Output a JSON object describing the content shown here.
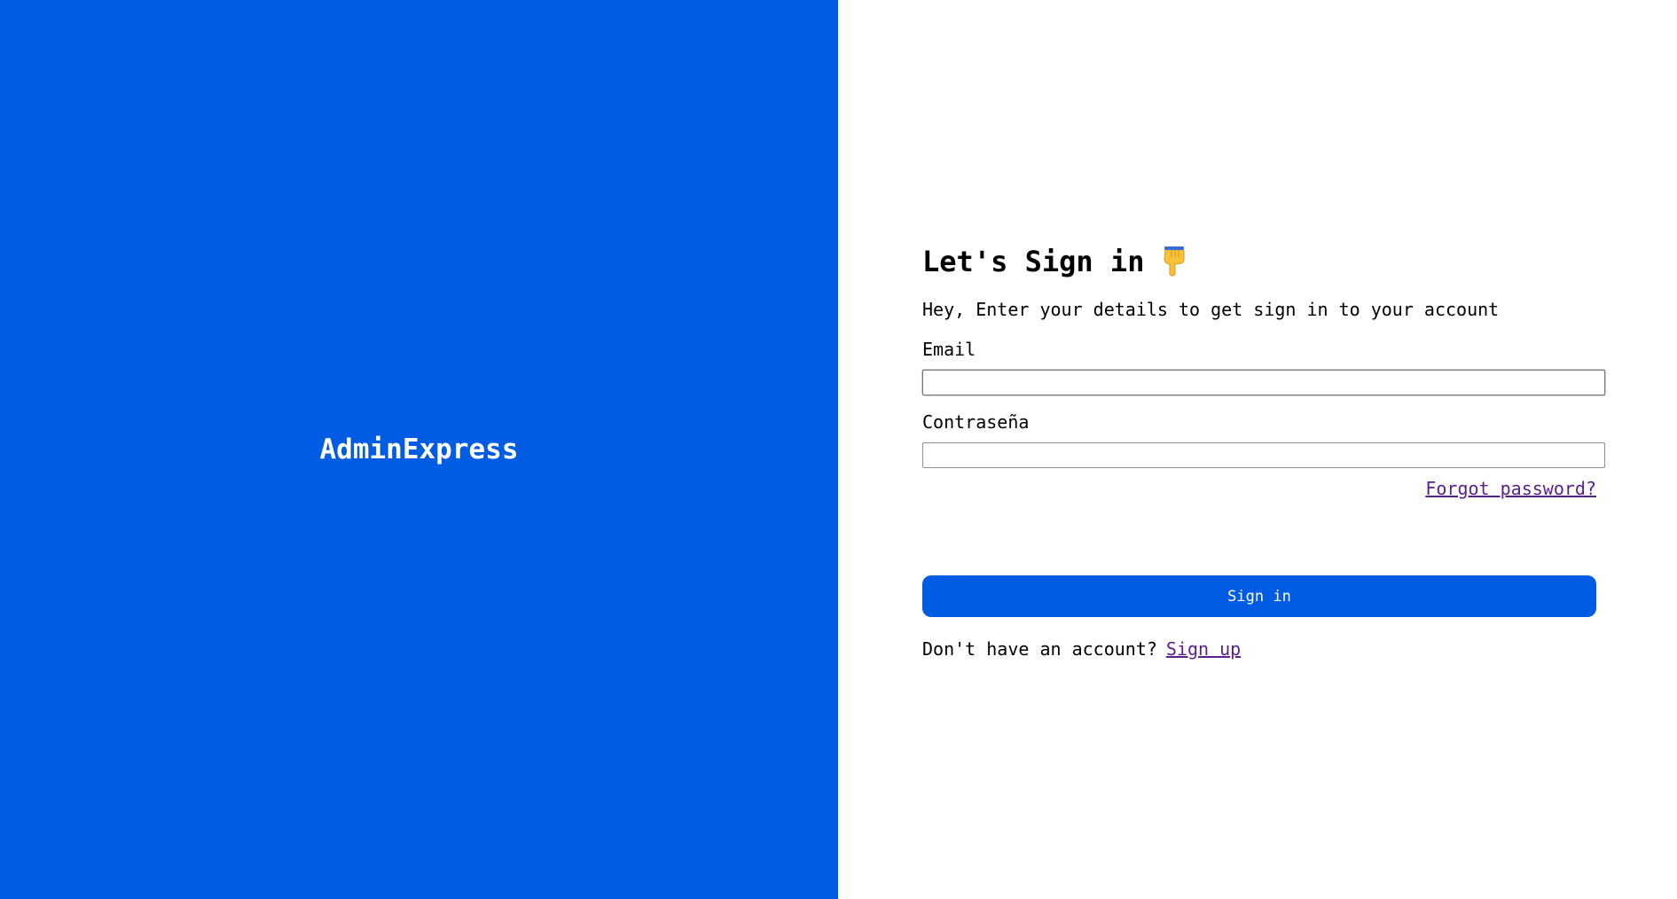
{
  "brand": {
    "name": "AdminExpress",
    "panel_color": "#005ce3"
  },
  "signin": {
    "title": "Let's Sign in",
    "title_icon": "backhand-index-pointing-down-icon",
    "subtitle": "Hey, Enter your details to get sign in to your account",
    "email_label": "Email",
    "email_value": "",
    "password_label": "Contraseña",
    "password_value": "",
    "forgot_link": "Forgot password?",
    "submit_label": "Sign in",
    "no_account_text": "Don't have an account?",
    "signup_link": "Sign up"
  },
  "colors": {
    "accent": "#005ce3",
    "link": "#5b1f8f",
    "text": "#000000"
  }
}
